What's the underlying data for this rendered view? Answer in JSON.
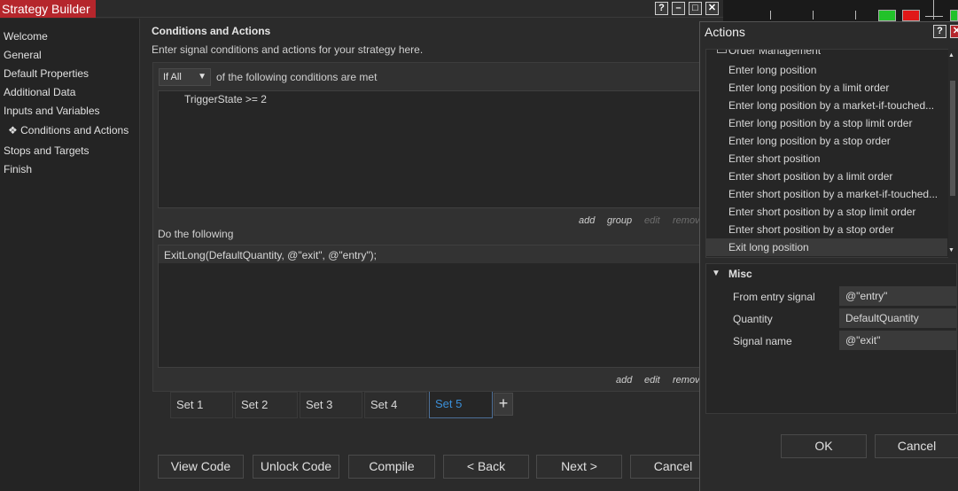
{
  "window": {
    "title": "Strategy Builder",
    "controls": [
      "?",
      "–",
      "□",
      "✕"
    ]
  },
  "sidebar": {
    "items": [
      {
        "label": "Welcome"
      },
      {
        "label": "General"
      },
      {
        "label": "Default Properties"
      },
      {
        "label": "Additional Data"
      },
      {
        "label": "Inputs and Variables"
      },
      {
        "label": "Conditions and Actions",
        "active": true,
        "marker": "❖"
      },
      {
        "label": "Stops and Targets"
      },
      {
        "label": "Finish"
      }
    ]
  },
  "content": {
    "heading": "Conditions and Actions",
    "description": "Enter signal conditions and actions for your strategy here.",
    "condition_mode": "If All",
    "condition_suffix": "of the following conditions are met",
    "conditions": [
      "TriggerState >= 2"
    ],
    "condition_links": {
      "add": "add",
      "group": "group",
      "edit": "edit",
      "remove": "remove"
    },
    "actions_heading": "Do the following",
    "actions": [
      "ExitLong(DefaultQuantity, @\"exit\", @\"entry\");"
    ],
    "action_links": {
      "add": "add",
      "edit": "edit",
      "remove": "remove"
    },
    "sets": [
      {
        "label": "Set 1"
      },
      {
        "label": "Set 2"
      },
      {
        "label": "Set 3"
      },
      {
        "label": "Set 4"
      },
      {
        "label": "Set 5",
        "active": true
      }
    ],
    "add_set_label": "+"
  },
  "footer_buttons": {
    "view_code": "View Code",
    "unlock_code": "Unlock Code",
    "compile": "Compile",
    "back": "< Back",
    "next": "Next >",
    "cancel": "Cancel"
  },
  "actions_dialog": {
    "title": "Actions",
    "controls": [
      "?",
      "✕"
    ],
    "group_label": "Order Management",
    "items": [
      "Enter long position",
      "Enter long position by a limit order",
      "Enter long position by a market-if-touched...",
      "Enter long position by a stop limit order",
      "Enter long position by a stop order",
      "Enter short position",
      "Enter short position by a limit order",
      "Enter short position by a market-if-touched...",
      "Enter short position by a stop limit order",
      "Enter short position by a stop order",
      "Exit long position"
    ],
    "selected_item": "Exit long position",
    "misc": {
      "heading": "Misc",
      "properties": [
        {
          "label": "From entry signal",
          "value": "@\"entry\""
        },
        {
          "label": "Quantity",
          "value": "DefaultQuantity"
        },
        {
          "label": "Signal name",
          "value": "@\"exit\""
        }
      ]
    },
    "ok_label": "OK",
    "cancel_label": "Cancel"
  },
  "colors": {
    "title_bar_accent": "#b5262c",
    "active_tab_text": "#3b8fd8",
    "green_marker": "#22c22a",
    "red_marker": "#e01818"
  }
}
